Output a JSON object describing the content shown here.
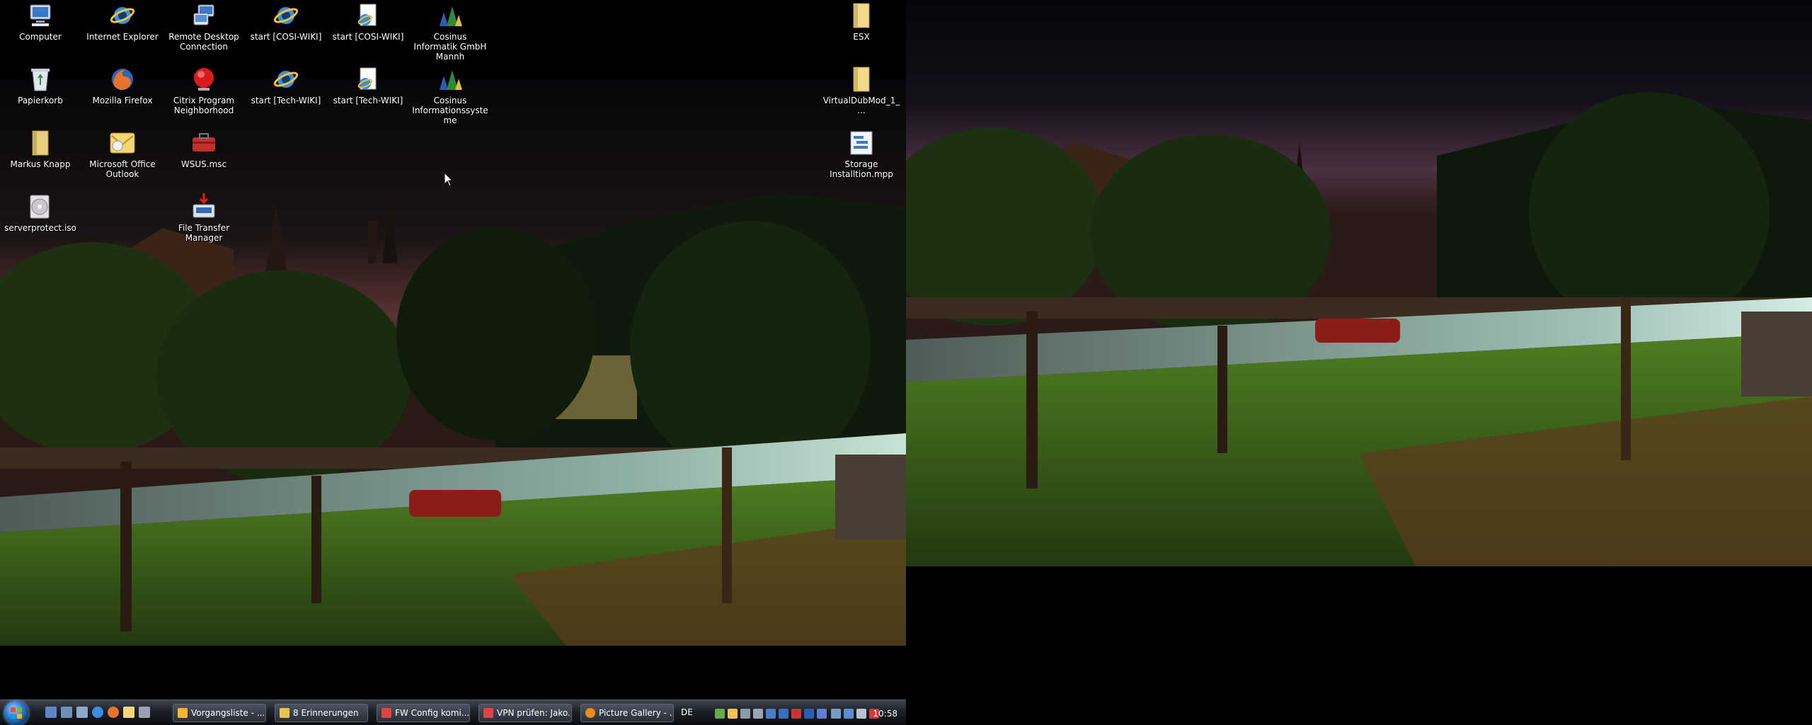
{
  "desktop_icons": {
    "computer": "Computer",
    "internet_explorer": "Internet Explorer",
    "remote_desktop": "Remote Desktop Connection",
    "start_cosi_wiki_1": "start [COSI-WIKI]",
    "start_cosi_wiki_2": "start [COSI-WIKI]",
    "cosinus_mannh": "Cosinus Informatik GmbH Mannh",
    "papierkorb": "Papierkorb",
    "mozilla_firefox": "Mozilla Firefox",
    "citrix": "Citrix Program Neighborhood",
    "start_tech_wiki_1": "start [Tech-WIKI]",
    "start_tech_wiki_2": "start [Tech-WIKI]",
    "cosinus_informationssysteme": "Cosinus Informationssysteme",
    "markus_knapp": "Markus Knapp",
    "outlook": "Microsoft Office Outlook",
    "wsus": "WSUS.msc",
    "serverprotect": "serverprotect.iso",
    "file_transfer": "File Transfer Manager",
    "esx": "ESX",
    "virtualdubmod": "VirtualDubMod_1_...",
    "storage_installation": "Storage Installtion.mpp"
  },
  "taskbar": {
    "tasks": [
      {
        "label": "Vorgangsliste - ...",
        "color": "#f2b632"
      },
      {
        "label": "8 Erinnerungen",
        "color": "#e8c452"
      },
      {
        "label": "FW Config komi...",
        "color": "#d44"
      },
      {
        "label": "VPN prüfen: Jako...",
        "color": "#d44"
      },
      {
        "label": "Picture Gallery - ...",
        "color": "#f08a1c"
      }
    ],
    "language": "DE",
    "clock": "10:58"
  },
  "colors": {
    "sky_top": "#07070c",
    "sky_glow": "#6a3a38",
    "grass": "#3d6b1f",
    "road": "#8fa7a0"
  }
}
